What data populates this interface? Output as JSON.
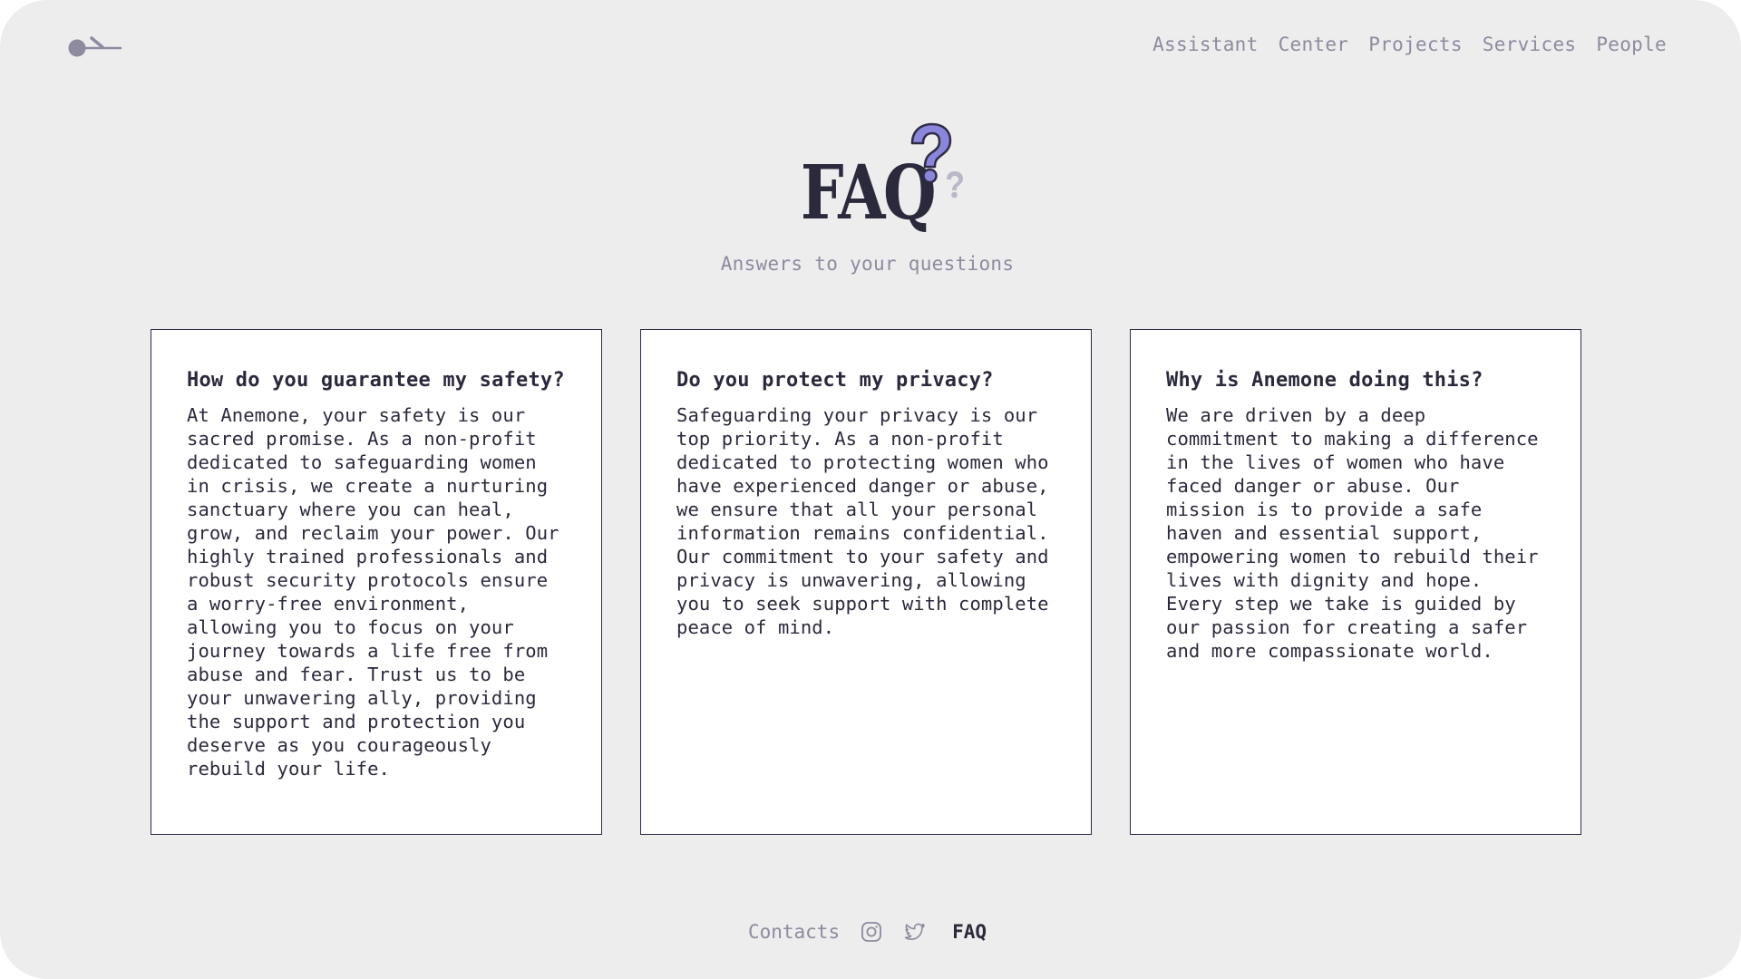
{
  "header": {
    "logo_icon": "anemone-logo-icon",
    "nav": [
      {
        "label": "Assistant"
      },
      {
        "label": "Center"
      },
      {
        "label": "Projects"
      },
      {
        "label": "Services"
      },
      {
        "label": "People"
      }
    ]
  },
  "hero": {
    "title": "FAQ",
    "subtitle": "Answers to your questions",
    "decoration_icon": "question-marks-icon"
  },
  "faq": [
    {
      "question": "How do you guarantee my safety?",
      "answer": "At Anemone, your safety is our sacred promise. As a non-profit dedicated to safeguarding women in crisis, we create a nurturing sanctuary where you can heal, grow, and reclaim your power. Our highly trained professionals and robust security protocols ensure a worry-free environment, allowing you to focus on your journey towards a life free from abuse and fear. Trust us to be your unwavering ally, providing the support and protection you deserve as you courageously rebuild your life."
    },
    {
      "question": "Do you protect my privacy?",
      "answer": "Safeguarding your privacy is our top priority. As a non-profit dedicated to protecting women who have experienced danger or abuse, we ensure that all your personal information remains confidential. Our commitment to your safety and privacy is unwavering, allowing you to seek support with complete peace of mind."
    },
    {
      "question": "Why is Anemone doing this?",
      "answer": "We are driven by a deep commitment to making a difference in the lives of women who have faced danger or abuse. Our mission is to provide a safe haven and essential support, empowering women to rebuild their lives with dignity and hope. Every step we take is guided by our passion for creating a safer and more compassionate world."
    }
  ],
  "footer": {
    "contacts_label": "Contacts",
    "instagram_icon": "instagram-icon",
    "twitter_icon": "twitter-icon",
    "faq_label": "FAQ"
  },
  "colors": {
    "background": "#ededee",
    "text_dark": "#2b2a3c",
    "text_muted": "#8d8b9d",
    "accent_purple": "#8a86dc",
    "accent_light": "#b9b7c8",
    "card_border": "#2e2c44"
  }
}
